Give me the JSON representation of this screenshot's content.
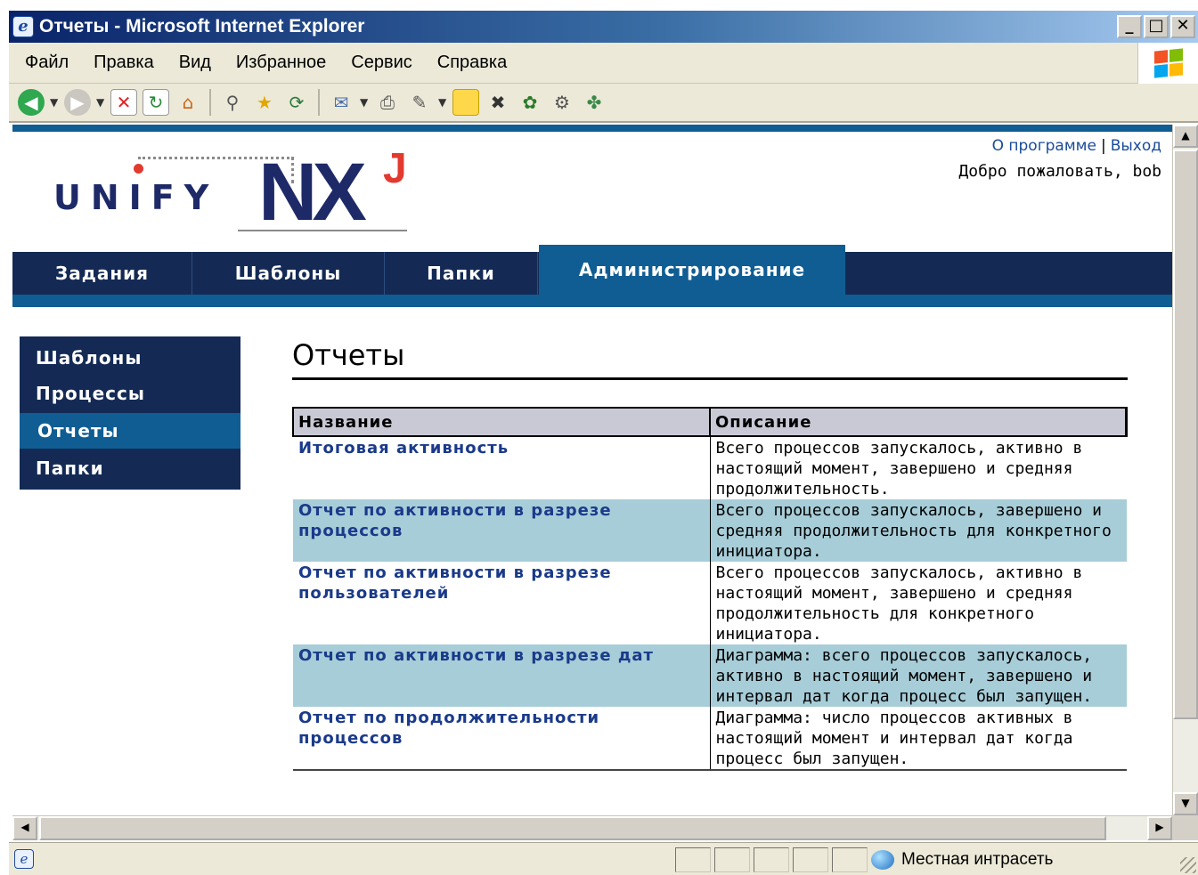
{
  "window": {
    "title": "Отчеты - Microsoft Internet Explorer",
    "app_icon": "ie-icon",
    "buttons": [
      "minimize",
      "maximize",
      "close"
    ]
  },
  "menubar": {
    "items": [
      "Файл",
      "Правка",
      "Вид",
      "Избранное",
      "Сервис",
      "Справка"
    ]
  },
  "toolbar": {
    "icons": [
      "back-icon",
      "forward-icon",
      "stop-icon",
      "refresh-icon",
      "home-icon",
      "search-icon",
      "favorites-icon",
      "history-icon",
      "mail-icon",
      "print-icon",
      "edit-icon",
      "note-icon",
      "messenger-icon",
      "pro-icon",
      "tools-icon",
      "extra-icon"
    ]
  },
  "header": {
    "logo_text": "UNIFY",
    "logo_nx": "NX",
    "logo_j": "J",
    "about_link": "О программе",
    "separator": "|",
    "logout_link": "Выход",
    "welcome": "Добро пожаловать, bob"
  },
  "nav": {
    "tabs": [
      {
        "label": "Задания",
        "active": false
      },
      {
        "label": "Шаблоны",
        "active": false
      },
      {
        "label": "Папки",
        "active": false
      },
      {
        "label": "Администрирование",
        "active": true
      }
    ]
  },
  "sidebar": {
    "items": [
      {
        "label": "Шаблоны",
        "active": false
      },
      {
        "label": "Процессы",
        "active": false
      },
      {
        "label": "Отчеты",
        "active": true
      },
      {
        "label": "Папки",
        "active": false
      }
    ]
  },
  "main": {
    "title": "Отчеты",
    "columns": [
      "Название",
      "Описание"
    ],
    "rows": [
      {
        "name": "Итоговая активность",
        "description": "Всего процессов запускалось, активно в настоящий момент, завершено и средняя продолжительность."
      },
      {
        "name": "Отчет по активности в разрезе процессов",
        "description": "Всего процессов запускалось, завершено и средняя продолжительность для конкретного инициатора."
      },
      {
        "name": "Отчет по активности в разрезе пользователей",
        "description": "Всего процессов запускалось, активно в настоящий момент, завершено и средняя продолжительность для конкретного инициатора."
      },
      {
        "name": "Отчет по активности в разрезе дат",
        "description": "Диаграмма: всего процессов запускалось, активно в настоящий момент, завершено и интервал дат когда процесс был запущен."
      },
      {
        "name": "Отчет по продолжительности процессов",
        "description": "Диаграмма: число процессов активных в настоящий момент и интервал дат когда процесс был запущен."
      }
    ]
  },
  "statusbar": {
    "zone": "Местная интрасеть"
  },
  "colors": {
    "nav_dark": "#142a55",
    "nav_active": "#0f5d93",
    "row_alt": "#a7cdd8",
    "link": "#1a3a8a",
    "logo_red": "#e23a2f"
  }
}
